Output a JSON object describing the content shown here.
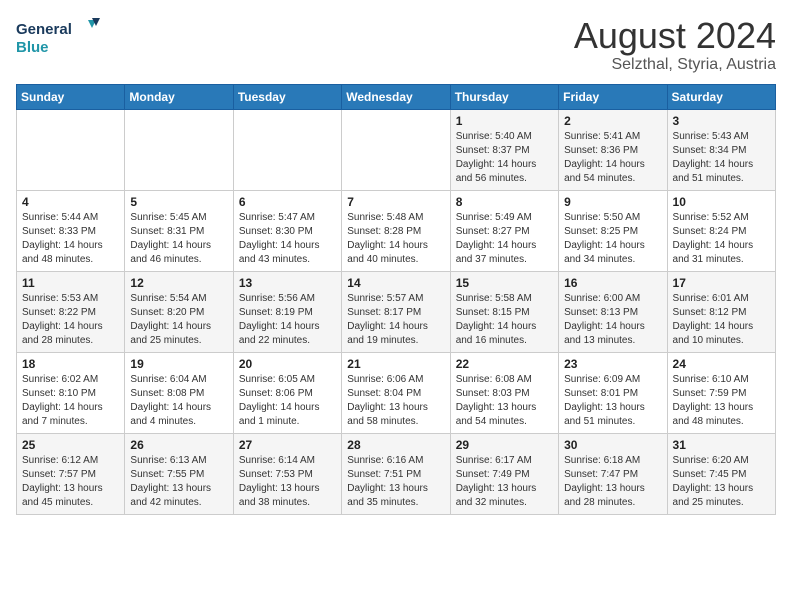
{
  "header": {
    "logo_line1": "General",
    "logo_line2": "Blue",
    "month_year": "August 2024",
    "location": "Selzthal, Styria, Austria"
  },
  "weekdays": [
    "Sunday",
    "Monday",
    "Tuesday",
    "Wednesday",
    "Thursday",
    "Friday",
    "Saturday"
  ],
  "weeks": [
    [
      {
        "day": "",
        "sunrise": "",
        "sunset": "",
        "daylight": ""
      },
      {
        "day": "",
        "sunrise": "",
        "sunset": "",
        "daylight": ""
      },
      {
        "day": "",
        "sunrise": "",
        "sunset": "",
        "daylight": ""
      },
      {
        "day": "",
        "sunrise": "",
        "sunset": "",
        "daylight": ""
      },
      {
        "day": "1",
        "sunrise": "Sunrise: 5:40 AM",
        "sunset": "Sunset: 8:37 PM",
        "daylight": "Daylight: 14 hours and 56 minutes."
      },
      {
        "day": "2",
        "sunrise": "Sunrise: 5:41 AM",
        "sunset": "Sunset: 8:36 PM",
        "daylight": "Daylight: 14 hours and 54 minutes."
      },
      {
        "day": "3",
        "sunrise": "Sunrise: 5:43 AM",
        "sunset": "Sunset: 8:34 PM",
        "daylight": "Daylight: 14 hours and 51 minutes."
      }
    ],
    [
      {
        "day": "4",
        "sunrise": "Sunrise: 5:44 AM",
        "sunset": "Sunset: 8:33 PM",
        "daylight": "Daylight: 14 hours and 48 minutes."
      },
      {
        "day": "5",
        "sunrise": "Sunrise: 5:45 AM",
        "sunset": "Sunset: 8:31 PM",
        "daylight": "Daylight: 14 hours and 46 minutes."
      },
      {
        "day": "6",
        "sunrise": "Sunrise: 5:47 AM",
        "sunset": "Sunset: 8:30 PM",
        "daylight": "Daylight: 14 hours and 43 minutes."
      },
      {
        "day": "7",
        "sunrise": "Sunrise: 5:48 AM",
        "sunset": "Sunset: 8:28 PM",
        "daylight": "Daylight: 14 hours and 40 minutes."
      },
      {
        "day": "8",
        "sunrise": "Sunrise: 5:49 AM",
        "sunset": "Sunset: 8:27 PM",
        "daylight": "Daylight: 14 hours and 37 minutes."
      },
      {
        "day": "9",
        "sunrise": "Sunrise: 5:50 AM",
        "sunset": "Sunset: 8:25 PM",
        "daylight": "Daylight: 14 hours and 34 minutes."
      },
      {
        "day": "10",
        "sunrise": "Sunrise: 5:52 AM",
        "sunset": "Sunset: 8:24 PM",
        "daylight": "Daylight: 14 hours and 31 minutes."
      }
    ],
    [
      {
        "day": "11",
        "sunrise": "Sunrise: 5:53 AM",
        "sunset": "Sunset: 8:22 PM",
        "daylight": "Daylight: 14 hours and 28 minutes."
      },
      {
        "day": "12",
        "sunrise": "Sunrise: 5:54 AM",
        "sunset": "Sunset: 8:20 PM",
        "daylight": "Daylight: 14 hours and 25 minutes."
      },
      {
        "day": "13",
        "sunrise": "Sunrise: 5:56 AM",
        "sunset": "Sunset: 8:19 PM",
        "daylight": "Daylight: 14 hours and 22 minutes."
      },
      {
        "day": "14",
        "sunrise": "Sunrise: 5:57 AM",
        "sunset": "Sunset: 8:17 PM",
        "daylight": "Daylight: 14 hours and 19 minutes."
      },
      {
        "day": "15",
        "sunrise": "Sunrise: 5:58 AM",
        "sunset": "Sunset: 8:15 PM",
        "daylight": "Daylight: 14 hours and 16 minutes."
      },
      {
        "day": "16",
        "sunrise": "Sunrise: 6:00 AM",
        "sunset": "Sunset: 8:13 PM",
        "daylight": "Daylight: 14 hours and 13 minutes."
      },
      {
        "day": "17",
        "sunrise": "Sunrise: 6:01 AM",
        "sunset": "Sunset: 8:12 PM",
        "daylight": "Daylight: 14 hours and 10 minutes."
      }
    ],
    [
      {
        "day": "18",
        "sunrise": "Sunrise: 6:02 AM",
        "sunset": "Sunset: 8:10 PM",
        "daylight": "Daylight: 14 hours and 7 minutes."
      },
      {
        "day": "19",
        "sunrise": "Sunrise: 6:04 AM",
        "sunset": "Sunset: 8:08 PM",
        "daylight": "Daylight: 14 hours and 4 minutes."
      },
      {
        "day": "20",
        "sunrise": "Sunrise: 6:05 AM",
        "sunset": "Sunset: 8:06 PM",
        "daylight": "Daylight: 14 hours and 1 minute."
      },
      {
        "day": "21",
        "sunrise": "Sunrise: 6:06 AM",
        "sunset": "Sunset: 8:04 PM",
        "daylight": "Daylight: 13 hours and 58 minutes."
      },
      {
        "day": "22",
        "sunrise": "Sunrise: 6:08 AM",
        "sunset": "Sunset: 8:03 PM",
        "daylight": "Daylight: 13 hours and 54 minutes."
      },
      {
        "day": "23",
        "sunrise": "Sunrise: 6:09 AM",
        "sunset": "Sunset: 8:01 PM",
        "daylight": "Daylight: 13 hours and 51 minutes."
      },
      {
        "day": "24",
        "sunrise": "Sunrise: 6:10 AM",
        "sunset": "Sunset: 7:59 PM",
        "daylight": "Daylight: 13 hours and 48 minutes."
      }
    ],
    [
      {
        "day": "25",
        "sunrise": "Sunrise: 6:12 AM",
        "sunset": "Sunset: 7:57 PM",
        "daylight": "Daylight: 13 hours and 45 minutes."
      },
      {
        "day": "26",
        "sunrise": "Sunrise: 6:13 AM",
        "sunset": "Sunset: 7:55 PM",
        "daylight": "Daylight: 13 hours and 42 minutes."
      },
      {
        "day": "27",
        "sunrise": "Sunrise: 6:14 AM",
        "sunset": "Sunset: 7:53 PM",
        "daylight": "Daylight: 13 hours and 38 minutes."
      },
      {
        "day": "28",
        "sunrise": "Sunrise: 6:16 AM",
        "sunset": "Sunset: 7:51 PM",
        "daylight": "Daylight: 13 hours and 35 minutes."
      },
      {
        "day": "29",
        "sunrise": "Sunrise: 6:17 AM",
        "sunset": "Sunset: 7:49 PM",
        "daylight": "Daylight: 13 hours and 32 minutes."
      },
      {
        "day": "30",
        "sunrise": "Sunrise: 6:18 AM",
        "sunset": "Sunset: 7:47 PM",
        "daylight": "Daylight: 13 hours and 28 minutes."
      },
      {
        "day": "31",
        "sunrise": "Sunrise: 6:20 AM",
        "sunset": "Sunset: 7:45 PM",
        "daylight": "Daylight: 13 hours and 25 minutes."
      }
    ]
  ]
}
